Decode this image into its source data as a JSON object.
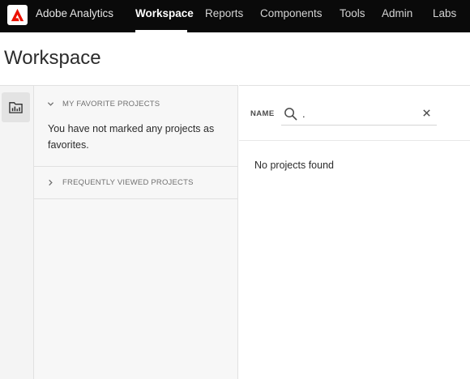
{
  "app": {
    "name": "Adobe Analytics",
    "logo_icon": "adobe-logo-icon"
  },
  "nav": {
    "items": [
      {
        "label": "Workspace",
        "active": true
      },
      {
        "label": "Reports",
        "active": false
      },
      {
        "label": "Components",
        "active": false
      },
      {
        "label": "Tools",
        "active": false
      },
      {
        "label": "Admin",
        "active": false
      },
      {
        "label": "Labs",
        "active": false
      }
    ]
  },
  "page": {
    "title": "Workspace"
  },
  "rail": {
    "projects_icon": "projects-folder-icon"
  },
  "sidebar": {
    "favorites": {
      "label": "MY FAVORITE PROJECTS",
      "expanded": true,
      "empty_message": "You have not marked any projects as favorites."
    },
    "frequent": {
      "label": "FREQUENTLY VIEWED PROJECTS",
      "expanded": false
    }
  },
  "filter": {
    "label": "NAME",
    "value": ".",
    "placeholder": ""
  },
  "results": {
    "empty_message": "No projects found"
  },
  "colors": {
    "topbar": "#0a0a0a",
    "logo_red": "#eb1000",
    "sidebar_bg": "#f7f7f7"
  }
}
